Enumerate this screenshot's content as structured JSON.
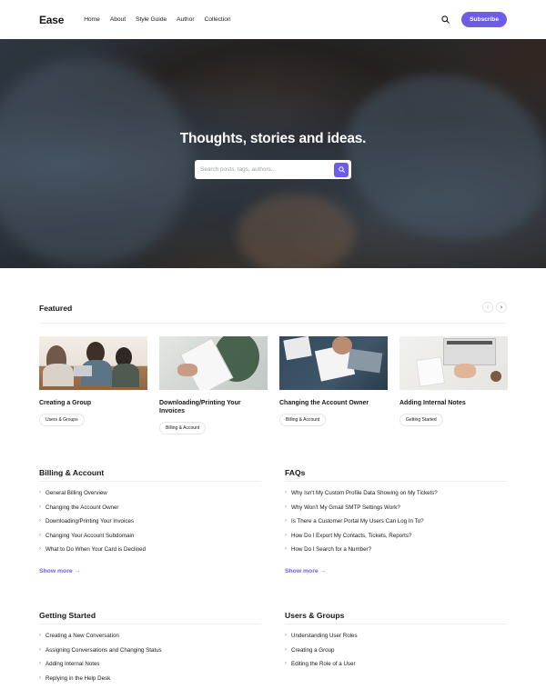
{
  "header": {
    "logo": "Ease",
    "nav": [
      "Home",
      "About",
      "Style Guide",
      "Author",
      "Collection"
    ],
    "subscribe": "Subscribe"
  },
  "hero": {
    "title": "Thoughts, stories and ideas.",
    "search_placeholder": "Search posts, tags, authors..."
  },
  "featured": {
    "title": "Featured",
    "prev": "‹",
    "next": "›",
    "cards": [
      {
        "title": "Creating a Group",
        "tag": "Users & Groups"
      },
      {
        "title": "Downloading/Printing Your Invoices",
        "tag": "Billing & Account"
      },
      {
        "title": "Changing the Account Owner",
        "tag": "Billing & Account"
      },
      {
        "title": "Adding Internal Notes",
        "tag": "Getting Started"
      }
    ]
  },
  "sections": [
    {
      "title": "Billing & Account",
      "items": [
        "General Billing Overview",
        "Changing the Account Owner",
        "Downloading/Printing Your Invoices",
        "Changing Your Account Subdomain",
        "What to Do When Your Card is Declined"
      ],
      "show_more": "Show more →"
    },
    {
      "title": "FAQs",
      "items": [
        "Why Isn't My Custom Profile Data Showing on My Tickets?",
        "Why Won't My Gmail SMTP Settings Work?",
        "Is There a Customer Portal My Users Can Log In To?",
        "How Do I Export My Contacts, Tickets, Reports?",
        "How Do I Search for a Number?"
      ],
      "show_more": "Show more →"
    },
    {
      "title": "Getting Started",
      "items": [
        "Creating a New Conversation",
        "Assigning Conversations and Changing Status",
        "Adding Internal Notes",
        "Replying in the Help Desk"
      ]
    },
    {
      "title": "Users & Groups",
      "items": [
        "Understanding User Roles",
        "Creating a Group",
        "Editing the Role of a User"
      ]
    }
  ],
  "colors": {
    "accent": "#6c5ce7",
    "text": "#15171a",
    "divider": "#eceef0"
  }
}
